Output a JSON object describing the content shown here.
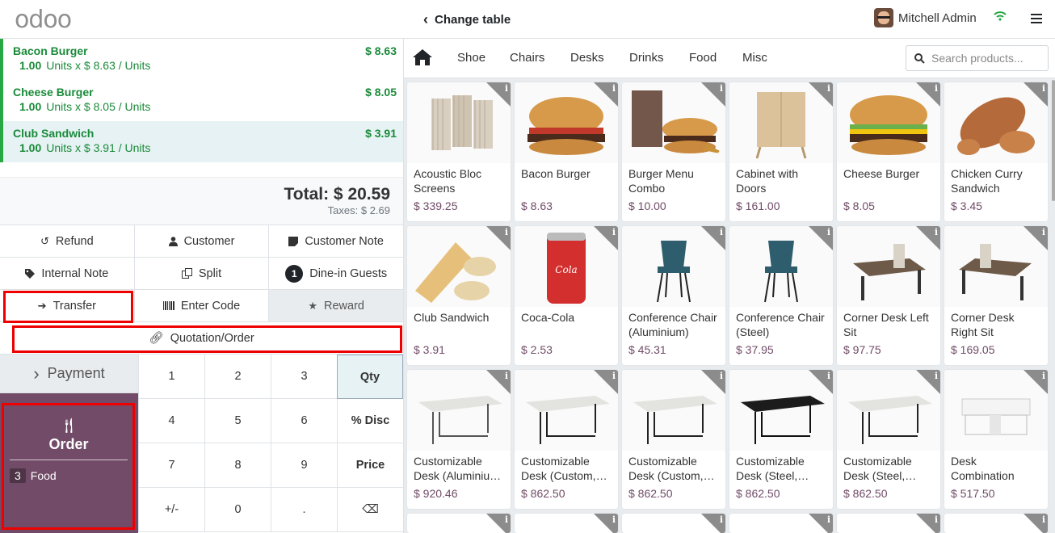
{
  "topbar": {
    "logo": "odoo",
    "back_label": "Change table",
    "user_name": "Mitchell Admin"
  },
  "order_lines": [
    {
      "name": "Bacon Burger",
      "price": "$ 8.63",
      "qty": "1.00",
      "unit_info": "Units x $ 8.63 / Units",
      "selected": false
    },
    {
      "name": "Cheese Burger",
      "price": "$ 8.05",
      "qty": "1.00",
      "unit_info": "Units x $ 8.05 / Units",
      "selected": false
    },
    {
      "name": "Club Sandwich",
      "price": "$ 3.91",
      "qty": "1.00",
      "unit_info": "Units x $ 3.91 / Units",
      "selected": true
    }
  ],
  "totals": {
    "total": "Total: $ 20.59",
    "taxes": "Taxes: $ 2.69"
  },
  "controls": {
    "refund": "Refund",
    "customer": "Customer",
    "customer_note": "Customer Note",
    "internal_note": "Internal Note",
    "split": "Split",
    "guests_count": "1",
    "dine_in_guests": "Dine-in Guests",
    "transfer": "Transfer",
    "enter_code": "Enter Code",
    "reward": "Reward",
    "quotation": "Quotation/Order"
  },
  "payment": {
    "label": "Payment"
  },
  "order_panel": {
    "title": "Order",
    "food_count": "3",
    "food_label": "Food"
  },
  "numpad": {
    "k1": "1",
    "k2": "2",
    "k3": "3",
    "qty": "Qty",
    "k4": "4",
    "k5": "5",
    "k6": "6",
    "disc": "% Disc",
    "k7": "7",
    "k8": "8",
    "k9": "9",
    "price": "Price",
    "plusminus": "+/-",
    "k0": "0",
    "dot": ".",
    "back": "⌫"
  },
  "categories": [
    "Shoe",
    "Chairs",
    "Desks",
    "Drinks",
    "Food",
    "Misc"
  ],
  "search": {
    "placeholder": "Search products..."
  },
  "products": [
    {
      "name": "Acoustic Bloc\nScreens",
      "price": "$ 339.25"
    },
    {
      "name": "Bacon Burger",
      "price": "$ 8.63"
    },
    {
      "name": "Burger Menu\nCombo",
      "price": "$ 10.00"
    },
    {
      "name": "Cabinet with\nDoors",
      "price": "$ 161.00"
    },
    {
      "name": "Cheese Burger",
      "price": "$ 8.05"
    },
    {
      "name": "Chicken Curry\nSandwich",
      "price": "$ 3.45"
    },
    {
      "name": "Club Sandwich",
      "price": "$ 3.91"
    },
    {
      "name": "Coca-Cola",
      "price": "$ 2.53"
    },
    {
      "name": "Conference Chair\n(Aluminium)",
      "price": "$ 45.31"
    },
    {
      "name": "Conference Chair\n(Steel)",
      "price": "$ 37.95"
    },
    {
      "name": "Corner Desk Left\nSit",
      "price": "$ 97.75"
    },
    {
      "name": "Corner Desk\nRight Sit",
      "price": "$ 169.05"
    },
    {
      "name": "Customizable\nDesk (Aluminiu…",
      "price": "$ 920.46"
    },
    {
      "name": "Customizable\nDesk (Custom,…",
      "price": "$ 862.50"
    },
    {
      "name": "Customizable\nDesk (Custom,…",
      "price": "$ 862.50"
    },
    {
      "name": "Customizable\nDesk (Steel,…",
      "price": "$ 862.50"
    },
    {
      "name": "Customizable\nDesk (Steel,…",
      "price": "$ 862.50"
    },
    {
      "name": "Desk\nCombination",
      "price": "$ 517.50"
    }
  ],
  "product_info_icon": "i",
  "colors": {
    "brand": "#714b67",
    "line_green": "#1a8a3a",
    "highlight": "#e00000"
  }
}
